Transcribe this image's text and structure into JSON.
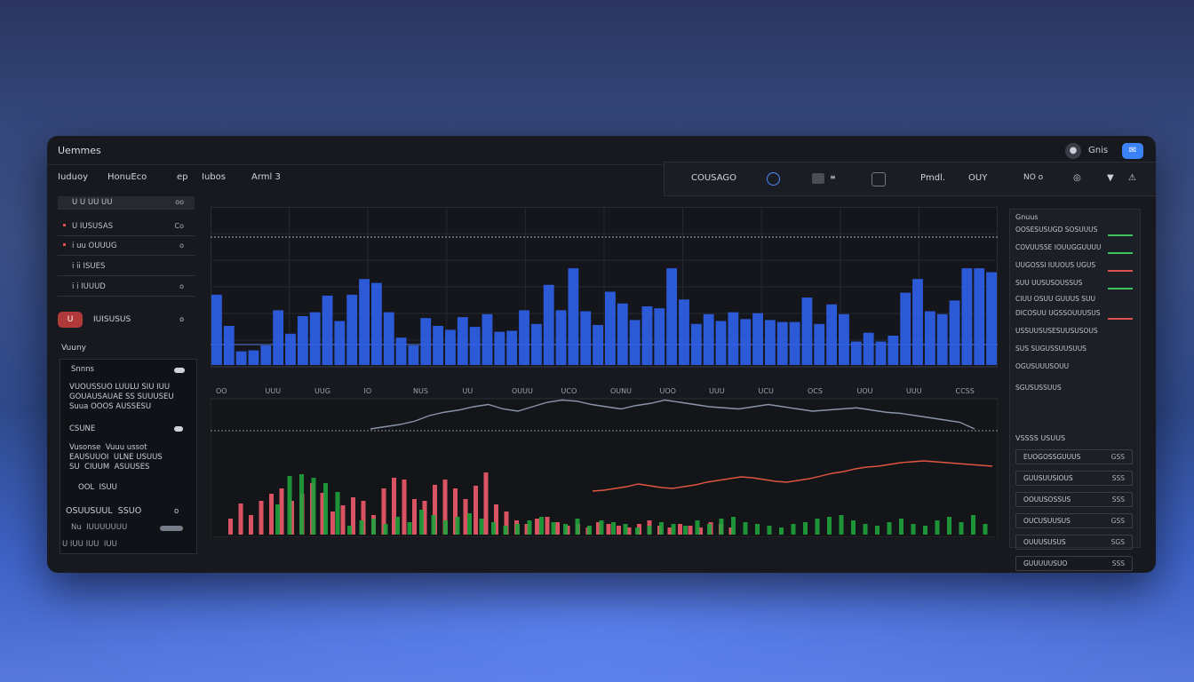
{
  "app": {
    "title": "Uemmes"
  },
  "titlebar": {
    "label": "Gnis",
    "accent_icon": "mail-icon",
    "icon": "user-icon"
  },
  "nav": [
    "Iuduoy",
    "HonuEco",
    "ep",
    "Iubos",
    "Arml 3"
  ],
  "toolbar": {
    "symbol": "COUSAGO",
    "field": "Pmdl.",
    "chip": "OUY",
    "mode": "NO o"
  },
  "left": {
    "rows": [
      {
        "label": "U U UU UU",
        "value": "oo"
      },
      {
        "label": "U IUSUSAS",
        "value": "Co"
      },
      {
        "label": "i uu OUUUG",
        "value": "o"
      },
      {
        "label": "i ii ISUES",
        "value": ""
      },
      {
        "label": "i i IUUUD",
        "value": "o"
      }
    ],
    "favorite": {
      "badge": "U",
      "label": "IUISUSUS",
      "value": "o"
    },
    "section": "Vuuny",
    "panel": {
      "title": "Snnns",
      "block1": "VUOUSSUO LUULU SIU IUU\nGOUAUSAUAE SS SUUUSEU\nSuua OOOS AUSSESU",
      "item1": "CSUNE",
      "block2": "Vusonse  Vuuu ussot\nEAUSUUOI  ULNE USUUS\nSU  CIUUM  ASUUSES",
      "item2": "OOL  ISUU",
      "footer": "OSUUSUUL  SSUO",
      "footer_val": "o",
      "row1": "Nu  IUUUUUUU",
      "row2": "U IUU IUU  IUU"
    }
  },
  "chart_data": {
    "type": "bar",
    "ylim": [
      0,
      100
    ],
    "tick_labels": [
      "OO",
      "UUU",
      "UUG",
      "IO",
      "NUS",
      "UU",
      "OUUU",
      "UCO",
      "OUNU",
      "UOO",
      "UUU",
      "UCU",
      "OCS",
      "UOU",
      "UUU",
      "CCSS"
    ],
    "price_panel": [
      {
        "name": "blue_volume",
        "color": "#2f5fe6",
        "values": [
          72,
          40,
          14,
          15,
          20,
          56,
          32,
          50,
          54,
          71,
          45,
          72,
          88,
          84,
          54,
          28,
          20,
          48,
          40,
          36,
          49,
          39,
          52,
          34,
          35,
          56,
          42,
          82,
          56,
          99,
          55,
          41,
          75,
          63,
          46,
          60,
          58,
          99,
          67,
          42,
          52,
          45,
          54,
          47,
          53,
          46,
          44,
          44,
          69,
          42,
          62,
          52,
          24,
          33,
          24,
          30,
          74,
          88,
          55,
          52,
          66,
          99,
          99,
          95
        ]
      },
      {
        "name": "upper_line",
        "color": "#8b94a8",
        "values": [
          40,
          42,
          44,
          47,
          52,
          55,
          57,
          60,
          62,
          58,
          56,
          60,
          64,
          66,
          65,
          62,
          60,
          58,
          61,
          63,
          66,
          64,
          62,
          60,
          59,
          58,
          60,
          62,
          60,
          58,
          56,
          57,
          58,
          59,
          57,
          55,
          54,
          52,
          50,
          48,
          46,
          40
        ]
      },
      {
        "name": "red_line",
        "color": "#e0563f",
        "values": [
          30,
          31,
          33,
          35,
          38,
          36,
          34,
          33,
          35,
          37,
          40,
          42,
          44,
          46,
          45,
          43,
          41,
          40,
          42,
          44,
          47,
          50,
          52,
          55,
          57,
          58,
          60,
          62,
          63,
          64,
          63,
          62,
          61,
          60,
          59,
          58
        ]
      }
    ],
    "volume_panel": [
      {
        "name": "red_volume",
        "color": "#f05a6a",
        "values": [
          18,
          35,
          22,
          38,
          46,
          52,
          38,
          46,
          58,
          47,
          26,
          33,
          42,
          38,
          22,
          52,
          64,
          62,
          40,
          38,
          56,
          62,
          52,
          40,
          55,
          70,
          34,
          26,
          16,
          12,
          18,
          20,
          14,
          10,
          12,
          8,
          14,
          12,
          10,
          8,
          12,
          16,
          10,
          8,
          12,
          10,
          8,
          14,
          12,
          8
        ]
      },
      {
        "name": "green_volume",
        "color": "#1fa23c",
        "values": [
          34,
          66,
          68,
          64,
          58,
          48,
          10,
          16,
          18,
          12,
          20,
          14,
          28,
          22,
          16,
          20,
          24,
          18,
          14,
          10,
          12,
          16,
          20,
          14,
          12,
          18,
          10,
          16,
          14,
          12,
          8,
          10,
          14,
          12,
          10,
          16,
          12,
          18,
          20,
          14,
          12,
          10,
          8,
          12,
          14,
          18,
          20,
          22,
          16,
          12,
          10,
          14,
          18,
          12,
          10,
          16,
          20,
          14,
          22,
          12
        ]
      }
    ]
  },
  "right": {
    "title": "Gnuus",
    "rows": [
      {
        "label": "OOSESUSUGD SOSUUUS",
        "bar": "#3fbf5f"
      },
      {
        "label": "COVUUSSE IOUUGGUUUU",
        "bar": "#3fbf5f"
      },
      {
        "label": "UUGOSSI  IUUOUS UGUS",
        "bar": "#e05050"
      },
      {
        "label": "SUU UUSUSOUSSUS",
        "bar": "#3fbf5f"
      },
      {
        "label": "CIUU OSUU GUUUS SUU",
        "bar": ""
      },
      {
        "label": "DICOSUU UGSSOUUUSUS",
        "bar": "#e05050"
      },
      {
        "label": "USSUUSUSESUUSUSOUS",
        "bar": ""
      },
      {
        "label": "SUS  SUGUSSUUSUUS",
        "bar": ""
      },
      {
        "label": "OGUSUUUSOUU",
        "bar": ""
      },
      {
        "label": "SGUSUSSUUS",
        "bar": ""
      }
    ],
    "section": "VSSSS USUUS",
    "boxes": [
      {
        "label": "EUOGOSSGUUUS",
        "value": "GSS"
      },
      {
        "label": "GUUSUUSIOUS",
        "value": "SSS"
      },
      {
        "label": "OOUUSOSSUS",
        "value": "SSS"
      },
      {
        "label": "OUCUSUUSUS",
        "value": "GSS"
      },
      {
        "label": "OUUUSUSUS",
        "value": "SGS"
      },
      {
        "label": "GUUUUUSUO",
        "value": "SSS"
      }
    ]
  }
}
